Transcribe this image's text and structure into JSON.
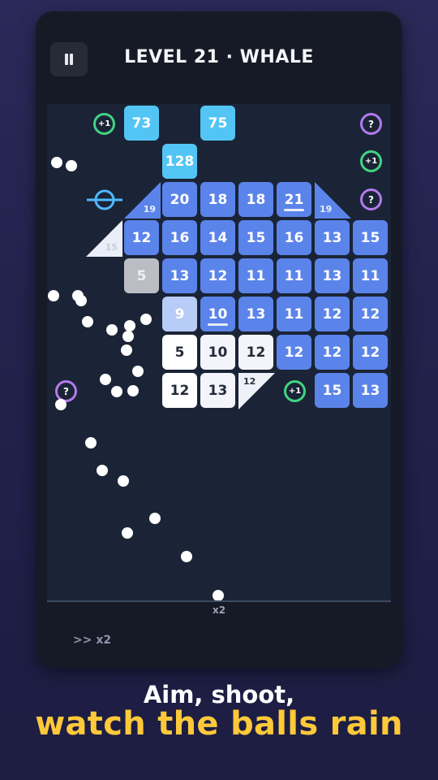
{
  "header": {
    "title": "LEVEL 21 · WHALE"
  },
  "board": {
    "bricks": {
      "r0c1": "73",
      "r0c3": "75",
      "r1c2": "128",
      "r2c2": "20",
      "r2c3": "18",
      "r2c4": "18",
      "r2c5": "21",
      "r3c1": "12",
      "r3c2": "16",
      "r3c3": "14",
      "r3c4": "15",
      "r3c5": "16",
      "r3c6": "13",
      "r3c7": "15",
      "r4c1": "5",
      "r4c2": "13",
      "r4c3": "12",
      "r4c4": "11",
      "r4c5": "11",
      "r4c6": "13",
      "r4c7": "11",
      "r5c2": "9",
      "r5c3": "10",
      "r5c4": "13",
      "r5c5": "11",
      "r5c6": "12",
      "r5c7": "12",
      "r6c2": "5",
      "r6c3": "10",
      "r6c4": "12",
      "r6c5": "12",
      "r6c6": "12",
      "r6c7": "12",
      "r7c2": "12",
      "r7c3": "13",
      "r7c6": "15",
      "r7c7": "13"
    },
    "triangles": {
      "t1": "19",
      "t2": "19",
      "t3": "15",
      "t4": "12"
    },
    "pickups": {
      "plus_label": "+1",
      "question_label": "?"
    },
    "launcher_multiplier": "x2"
  },
  "controls": {
    "speed_label": ">> x2"
  },
  "caption": {
    "line1": "Aim, shoot,",
    "line2": "watch the balls rain"
  },
  "colors": {
    "brick_blue": "#5b84ea",
    "brick_cyan": "#53c5f5",
    "plus_ring": "#40d483",
    "question_ring": "#b479ee",
    "caption_yellow": "#ffc93a",
    "laser": "#4fb8ff"
  },
  "icons": {
    "pause": "pause-icon",
    "laser": "laser-ring-icon"
  }
}
